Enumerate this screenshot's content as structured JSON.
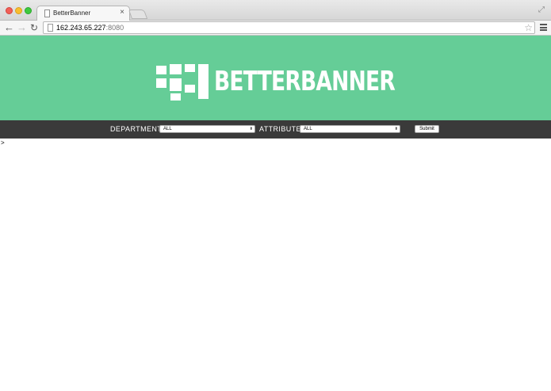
{
  "browser": {
    "tab": {
      "title": "BetterBanner",
      "close_glyph": "×"
    },
    "nav": {
      "back_glyph": "←",
      "forward_glyph": "→",
      "reload_glyph": "↻"
    },
    "address": {
      "host": "162.243.65.227",
      "port": ":8080"
    },
    "icons": {
      "star": "☆",
      "fullscreen": "⤢"
    }
  },
  "banner": {
    "logo_text": "BETTERBANNER",
    "background_color": "#65cd97"
  },
  "filters": {
    "department": {
      "label": "DEPARTMENT:",
      "selected": "ALL"
    },
    "attribute": {
      "label": "ATTRIBUTE:",
      "selected": "ALL"
    },
    "submit_label": "Submit",
    "select_arrow": "⬍",
    "bar_color": "#3a3a3a"
  },
  "content": {
    "stray_text": ">"
  }
}
